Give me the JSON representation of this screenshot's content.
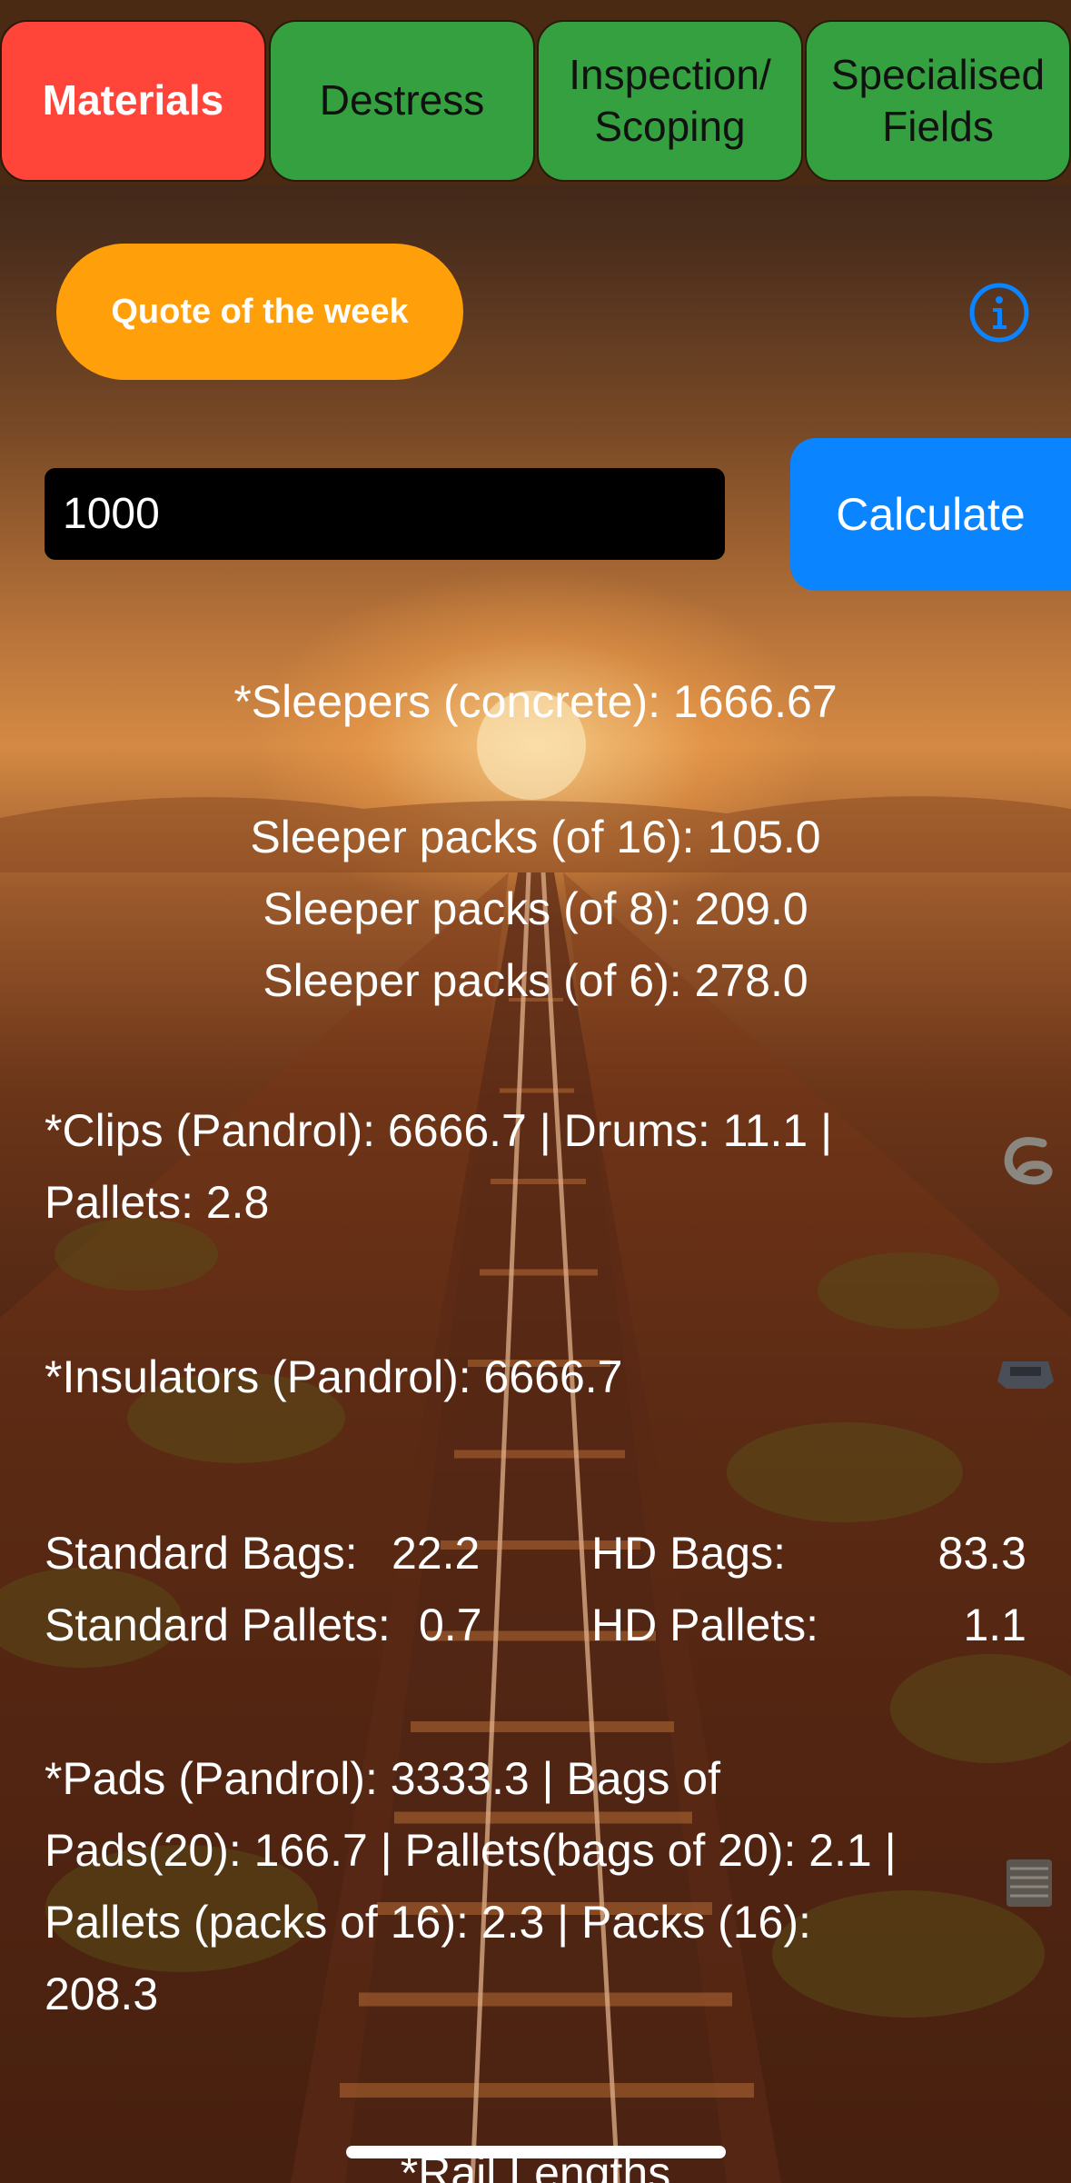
{
  "tabs": [
    {
      "line1": "Materials",
      "line2": "",
      "active": true
    },
    {
      "line1": "Destress",
      "line2": "",
      "active": false
    },
    {
      "line1": "Inspection/",
      "line2": "Scoping",
      "active": false
    },
    {
      "line1": "Specialised",
      "line2": "Fields",
      "active": false
    }
  ],
  "quote_button": "Quote of the week",
  "length_input": {
    "value": "1000"
  },
  "calculate_button": "Calculate",
  "sleepers": {
    "total": "*Sleepers (concrete): 1666.67",
    "packs16": "Sleeper packs (of 16):   105.0",
    "packs8": "Sleeper packs (of 8): 209.0",
    "packs6": "Sleeper packs (of 6):   278.0"
  },
  "clips": {
    "line1": "*Clips (Pandrol): 6666.7 | Drums: 11.1 |",
    "line2": "Pallets: 2.8"
  },
  "insulators": "*Insulators (Pandrol): 6666.7",
  "bags": {
    "standard_bags_label": "Standard Bags:",
    "standard_bags_value": "22.2",
    "hd_bags_label": "HD Bags:",
    "hd_bags_value": "83.3",
    "standard_pallets_label": "Standard Pallets:",
    "standard_pallets_value": "0.7",
    "hd_pallets_label": "HD Pallets:",
    "hd_pallets_value": "1.1"
  },
  "pads": {
    "line1": "*Pads (Pandrol): 3333.3 | Bags of",
    "line2": "Pads(20): 166.7 | Pallets(bags of 20): 2.1 |",
    "line3": "Pallets (packs of 16): 2.3 | Packs (16):",
    "line4": "208.3"
  },
  "rail_lengths": "*Rail Lengths",
  "colors": {
    "active_tab": "#ff453a",
    "inactive_tab": "#35a03f",
    "quote_button": "#ff9f0a",
    "calculate_button": "#0a84ff",
    "info_icon": "#0a84ff"
  },
  "icons": [
    "info-circle-icon",
    "clip-icon",
    "insulator-icon",
    "pad-icon"
  ]
}
